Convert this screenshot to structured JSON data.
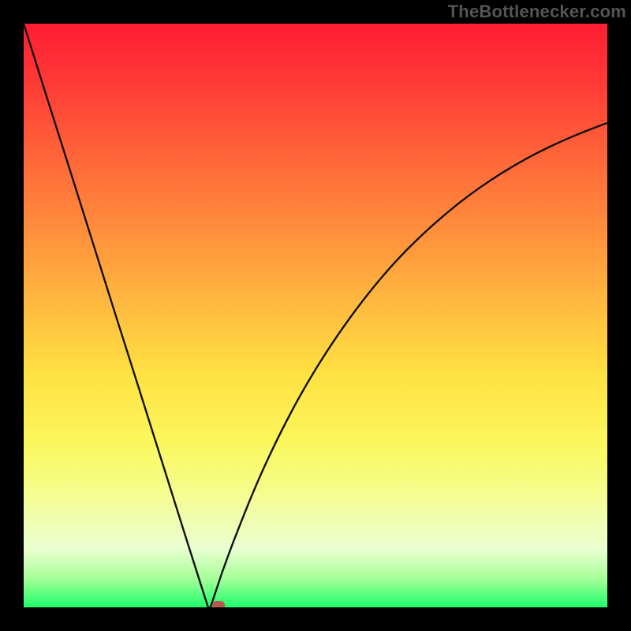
{
  "watermark": "TheBottlenecker.com",
  "colors": {
    "background": "#000000",
    "curve_stroke": "#111111",
    "marker_fill": "#b55a4e",
    "gradient_top": "#ff1d33",
    "gradient_bottom": "#1dff6c"
  },
  "chart_data": {
    "type": "line",
    "title": "",
    "xlabel": "",
    "ylabel": "",
    "xlim": [
      0,
      100
    ],
    "ylim": [
      0,
      100
    ],
    "grid": false,
    "legend": false,
    "x": [
      0,
      4,
      8,
      12,
      16,
      20,
      24,
      28,
      31.6,
      32.0,
      34,
      36,
      40,
      44,
      48,
      52,
      56,
      60,
      64,
      68,
      72,
      76,
      80,
      84,
      88,
      92,
      96,
      100
    ],
    "values": [
      100,
      87.3,
      74.7,
      62.0,
      49.3,
      36.7,
      24.0,
      11.3,
      0.0,
      0.0,
      6.0,
      11.5,
      21.5,
      30.0,
      37.5,
      44.0,
      49.8,
      55.0,
      59.6,
      63.6,
      67.2,
      70.4,
      73.2,
      75.7,
      77.9,
      79.8,
      81.5,
      83.0
    ],
    "marker": {
      "x": 33.4,
      "y": 0.0,
      "shape": "rounded-rect"
    },
    "notes": "x is normalized horizontal position (0=left edge of plot area, 100=right). y is normalized vertical value (0=bottom/green, 100=top/red). Left branch is a descending line from (0,100) to (~31.6,0); short flat segment at y=0; right branch is an increasing concave curve approaching ~83 at x=100."
  }
}
